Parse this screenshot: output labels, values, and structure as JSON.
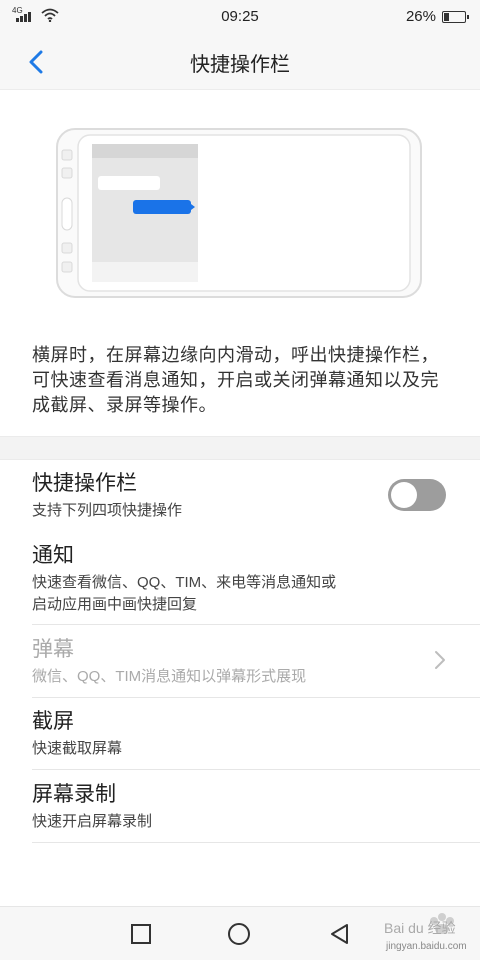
{
  "status_bar": {
    "network_type": "4G",
    "time": "09:25",
    "battery_percent": "26%",
    "battery_level": 0.26,
    "icons": [
      "signal-icon",
      "wifi-icon",
      "battery-icon"
    ]
  },
  "header": {
    "title": "快捷操作栏",
    "back_icon": "chevron-left-icon"
  },
  "description": "横屏时，在屏幕边缘向内滑动，呼出快捷操作栏，可快速查看消息通知，开启或关闭弹幕通知以及完成截屏、录屏等操作。",
  "settings": [
    {
      "title": "快捷操作栏",
      "subtitle": "支持下列四项快捷操作",
      "toggle_on": false
    },
    {
      "title": "通知",
      "subtitle": "快速查看微信、QQ、TIM、来电等消息通知或启动应用画中画快捷回复"
    },
    {
      "title": "弹幕",
      "subtitle": "微信、QQ、TIM消息通知以弹幕形式展现",
      "enabled": false,
      "icon": "chevron-right-icon"
    },
    {
      "title": "截屏",
      "subtitle": "快速截取屏幕"
    },
    {
      "title": "屏幕录制",
      "subtitle": "快速开启屏幕录制"
    }
  ],
  "settings_lines": {
    "notification_line1": "快速查看微信、QQ、TIM、来电等消息通知或",
    "notification_line2": "启动应用画中画快捷回复"
  },
  "nav_bar": {
    "icons": [
      "recents-square-icon",
      "home-circle-icon",
      "back-triangle-icon"
    ]
  },
  "watermark": {
    "text": "Bai du 经验",
    "url_text": "jingyan.baidu.com"
  },
  "colors": {
    "accent_blue": "#1e7ae6",
    "toggle_off": "#9d9d9d",
    "illustration_stroke": "#dcdcdc",
    "bubble_blue": "#1a73e8"
  }
}
